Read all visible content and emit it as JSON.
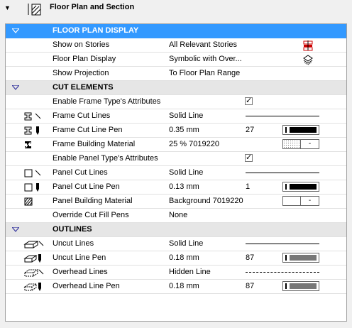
{
  "header": {
    "title": "Floor Plan and Section"
  },
  "sections": {
    "floor_plan_display": {
      "title": "FLOOR PLAN DISPLAY",
      "rows": [
        {
          "name": "Show on Stories",
          "value": "All Relevant Stories",
          "icon": "stories-icon"
        },
        {
          "name": "Floor Plan Display",
          "value": "Symbolic with Over...",
          "icon": "floor-plan-display-icon"
        },
        {
          "name": "Show Projection",
          "value": "To Floor Plan Range"
        }
      ]
    },
    "cut_elements": {
      "title": "CUT ELEMENTS",
      "enable_frame": {
        "name": "Enable Frame Type's Attributes",
        "checked": true
      },
      "frame_cut_lines": {
        "name": "Frame Cut Lines",
        "value": "Solid Line"
      },
      "frame_cut_line_pen": {
        "name": "Frame Cut Line Pen",
        "value": "0.35 mm",
        "pen": "27"
      },
      "frame_building_material": {
        "name": "Frame Building Material",
        "value": "25 % 7019220"
      },
      "enable_panel": {
        "name": "Enable Panel Type's Attributes",
        "checked": true
      },
      "panel_cut_lines": {
        "name": "Panel Cut Lines",
        "value": "Solid Line"
      },
      "panel_cut_line_pen": {
        "name": "Panel Cut Line Pen",
        "value": "0.13 mm",
        "pen": "1"
      },
      "panel_building_material": {
        "name": "Panel Building Material",
        "value": "Background 7019220"
      },
      "override_cut_fill": {
        "name": "Override Cut Fill Pens",
        "value": "None"
      }
    },
    "outlines": {
      "title": "OUTLINES",
      "uncut_lines": {
        "name": "Uncut Lines",
        "value": "Solid Line"
      },
      "uncut_line_pen": {
        "name": "Uncut Line Pen",
        "value": "0.18 mm",
        "pen": "87"
      },
      "overhead_lines": {
        "name": "Overhead Lines",
        "value": "Hidden Line"
      },
      "overhead_line_pen": {
        "name": "Overhead Line Pen",
        "value": "0.18 mm",
        "pen": "87"
      }
    }
  },
  "swatch_minus": "-",
  "checkmark": "✓"
}
